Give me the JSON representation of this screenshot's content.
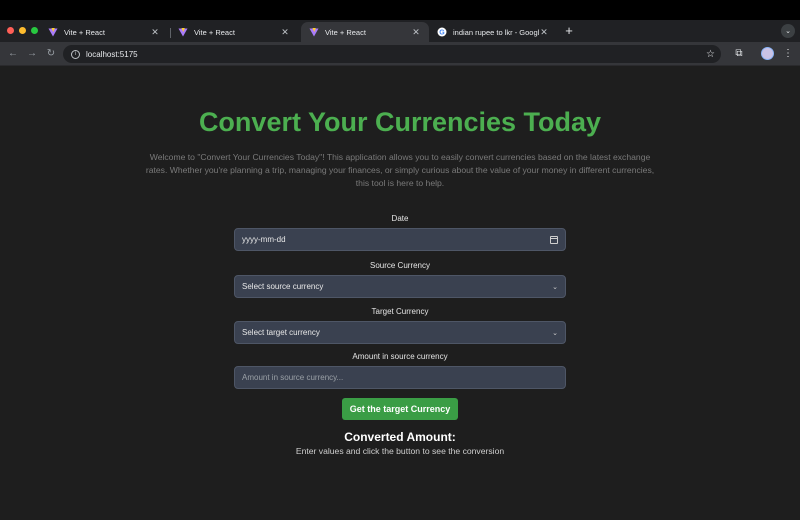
{
  "browser": {
    "tabs": [
      {
        "label": "Vite + React",
        "icon": "vite-icon"
      },
      {
        "label": "Vite + React",
        "icon": "vite-icon"
      },
      {
        "label": "Vite + React",
        "icon": "vite-icon",
        "active": true
      },
      {
        "label": "indian rupee to lkr - Google S",
        "icon": "google-icon"
      }
    ],
    "url": "localhost:5175"
  },
  "page": {
    "title": "Convert Your Currencies Today",
    "intro": "Welcome to \"Convert Your Currencies Today\"! This application allows you to easily convert currencies based on the latest exchange rates. Whether you're planning a trip, managing your finances, or simply curious about the value of your money in different currencies, this tool is here to help.",
    "date_label": "Date",
    "date_placeholder": "yyyy-mm-dd",
    "source_label": "Source Currency",
    "source_selected": "Select source currency",
    "target_label": "Target Currency",
    "target_selected": "Select target currency",
    "amount_label": "Amount in source currency",
    "amount_placeholder": "Amount in source currency...",
    "button_label": "Get the target Currency",
    "converted_title": "Converted Amount:",
    "converted_text": "Enter values and click the button to see the conversion"
  },
  "colors": {
    "accent": "#4caf50",
    "button": "#3a9d45",
    "background": "#1e1e1e",
    "field": "#3a4150"
  }
}
